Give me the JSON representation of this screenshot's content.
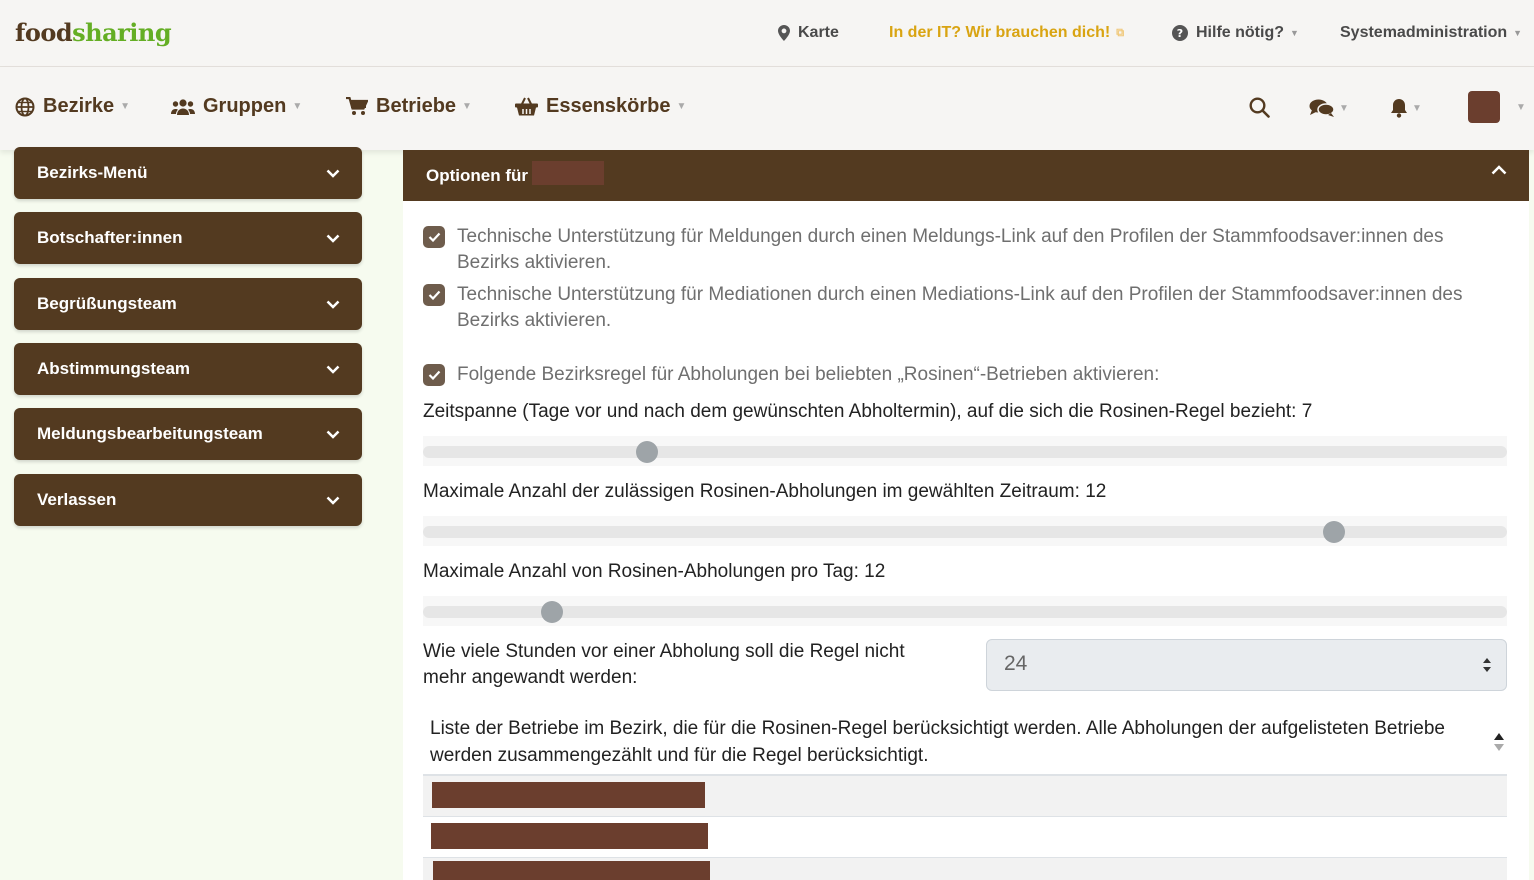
{
  "header": {
    "logo_part1": "food",
    "logo_part2": "sharing",
    "links": {
      "map": "Karte",
      "it_help": "In der IT? Wir brauchen dich!",
      "help": "Hilfe nötig?",
      "admin": "Systemadministration"
    }
  },
  "nav": {
    "items": [
      "Bezirke",
      "Gruppen",
      "Betriebe",
      "Essenskörbe"
    ]
  },
  "sidebar": {
    "items": [
      "Bezirks-Menü",
      "Botschafter:innen",
      "Begrüßungsteam",
      "Abstimmungsteam",
      "Meldungsbearbeitungsteam",
      "Verlassen"
    ]
  },
  "panel": {
    "title": "Optionen für",
    "checkbox_report": "Technische Unterstützung für Meldungen durch einen Meldungs-Link auf den Profilen der Stammfoodsaver:innen des Bezirks aktivieren.",
    "checkbox_mediation": "Technische Unterstützung für Mediationen durch einen Mediations-Link auf den Profilen der Stammfoodsaver:innen des Bezirks aktivieren.",
    "checkbox_rosinen": "Folgende Bezirksregel für Abholungen bei beliebten „Rosinen“-Betrieben aktivieren:",
    "slider_timespan_label": "Zeitspanne (Tage vor und nach dem gewünschten Abholtermin), auf die sich die Rosinen-Regel bezieht: 7",
    "slider_timespan_level": 0.207,
    "slider_max_label": "Maximale Anzahl der zulässigen Rosinen-Abholungen im gewählten Zeitraum: 12",
    "slider_max_level": 0.84,
    "slider_day_label": "Maximale Anzahl von Rosinen-Abholungen pro Tag: 12",
    "slider_day_level": 0.119,
    "hours_label": "Wie viele Stunden vor einer Abholung soll die Regel nicht mehr angewandt werden:",
    "hours_value": "24",
    "list_header": "Liste der Betriebe im Bezirk, die für die Rosinen-Regel berücksichtigt werden. Alle Abholungen der aufgelisteten Betriebe werden zusammengezählt und für die Regel berücksichtigt."
  },
  "colors": {
    "brown": "#533a20",
    "green": "#64ae24",
    "it_yellow": "#d9a412",
    "redaction": "#6b3e2e"
  }
}
